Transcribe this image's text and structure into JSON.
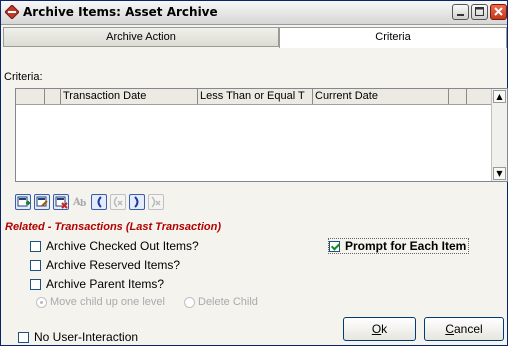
{
  "window": {
    "title": "Archive Items:  Asset Archive"
  },
  "tabs": [
    {
      "label": "Archive Action",
      "active": false
    },
    {
      "label": "Criteria",
      "active": true
    }
  ],
  "criteria": {
    "label": "Criteria:",
    "columns": [
      "",
      "",
      "Transaction Date",
      "Less Than or Equal T",
      "Current Date",
      "",
      ""
    ]
  },
  "section": {
    "title": "Related - Transactions (Last Transaction)"
  },
  "checkboxes": {
    "archive_checked_out": {
      "label": "Archive Checked Out Items?",
      "checked": false
    },
    "archive_reserved": {
      "label": "Archive Reserved Items?",
      "checked": false
    },
    "archive_parent": {
      "label": "Archive Parent Items?",
      "checked": false
    },
    "prompt_each": {
      "label": "Prompt for Each Item",
      "checked": true
    },
    "no_user_interaction": {
      "label": "No User-Interaction",
      "checked": false
    }
  },
  "radios": {
    "move_child": {
      "label": "Move child up one level",
      "selected": true
    },
    "delete_child": {
      "label": "Delete Child",
      "selected": false
    }
  },
  "buttons": {
    "ok": {
      "mnemonic": "O",
      "rest": "k"
    },
    "cancel": {
      "mnemonic": "C",
      "rest": "ancel"
    }
  },
  "colors": {
    "section_title": "#b30000",
    "title_close": "#d04020",
    "check": "#1b8a1b"
  }
}
